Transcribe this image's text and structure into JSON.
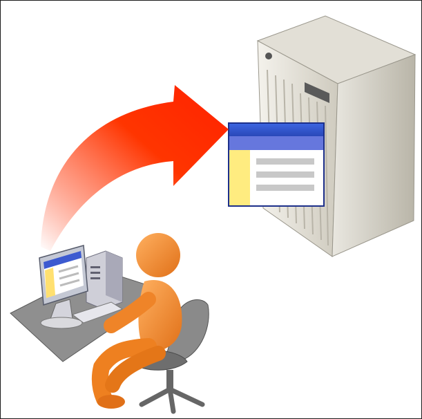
{
  "illustration": {
    "icons": [
      "server-tower-icon",
      "web-page-window-icon",
      "upload-arrow-icon",
      "desktop-computer-icon",
      "user-figure-icon",
      "office-chair-icon"
    ],
    "colors": {
      "frame_border": "#1a1a1a",
      "arrow": "#ff2a00",
      "person": "#f28a2c",
      "window_title": "#4a66cc",
      "window_sidebar": "#ffee88",
      "server": "#d8d4c8",
      "desk": "#8a8a8a",
      "chair": "#707070"
    }
  }
}
